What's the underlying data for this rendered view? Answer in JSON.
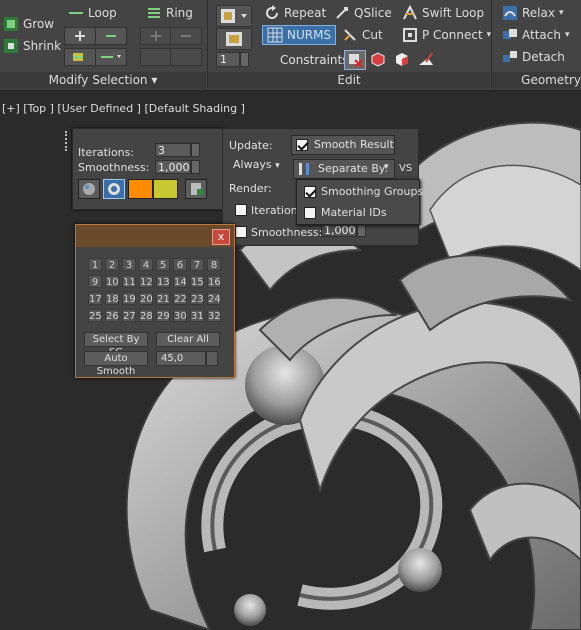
{
  "ribbon": {
    "grow": "Grow",
    "shrink": "Shrink",
    "loop": "Loop",
    "ring": "Ring",
    "repeat": "Repeat",
    "qslice": "QSlice",
    "swift_loop": "Swift Loop",
    "nurms": "NURMS",
    "cut": "Cut",
    "p_connect": "P Connect",
    "constraints": "Constraints:",
    "relax": "Relax",
    "attach": "Attach",
    "detach": "Detach",
    "spinner_value": "1",
    "panel_modify_selection": "Modify Selection ▾",
    "panel_edit": "Edit",
    "panel_geometry": "Geometry"
  },
  "viewport": {
    "label": "[+] [Top ] [User Defined ] [Default Shading ]"
  },
  "caddy": {
    "iterations_label": "Iterations:",
    "iterations_value": "3",
    "smoothness_label": "Smoothness:",
    "smoothness_value": "1,000",
    "update_label": "Update:",
    "update_value": "Always",
    "smooth_result": "Smooth Result",
    "separate_by": "Separate By:",
    "render_label": "Render:",
    "render_iterations": "Iterations",
    "render_smoothness": "Smoothness:",
    "render_smoothness_value": "1,000",
    "swatch_orange": "#ff8c00",
    "swatch_yellow": "#c8c832"
  },
  "dropdown": {
    "items": [
      "Smoothing Groups",
      "Material IDs"
    ]
  },
  "smoothing_groups": {
    "numbers": [
      "1",
      "2",
      "3",
      "4",
      "5",
      "6",
      "7",
      "8",
      "9",
      "10",
      "11",
      "12",
      "13",
      "14",
      "15",
      "16",
      "17",
      "18",
      "19",
      "20",
      "21",
      "22",
      "23",
      "24",
      "25",
      "26",
      "27",
      "28",
      "29",
      "30",
      "31",
      "32"
    ],
    "select_by_sg": "Select By SG",
    "clear_all": "Clear All",
    "auto_smooth": "Auto Smooth",
    "auto_smooth_value": "45,0",
    "close": "x"
  }
}
